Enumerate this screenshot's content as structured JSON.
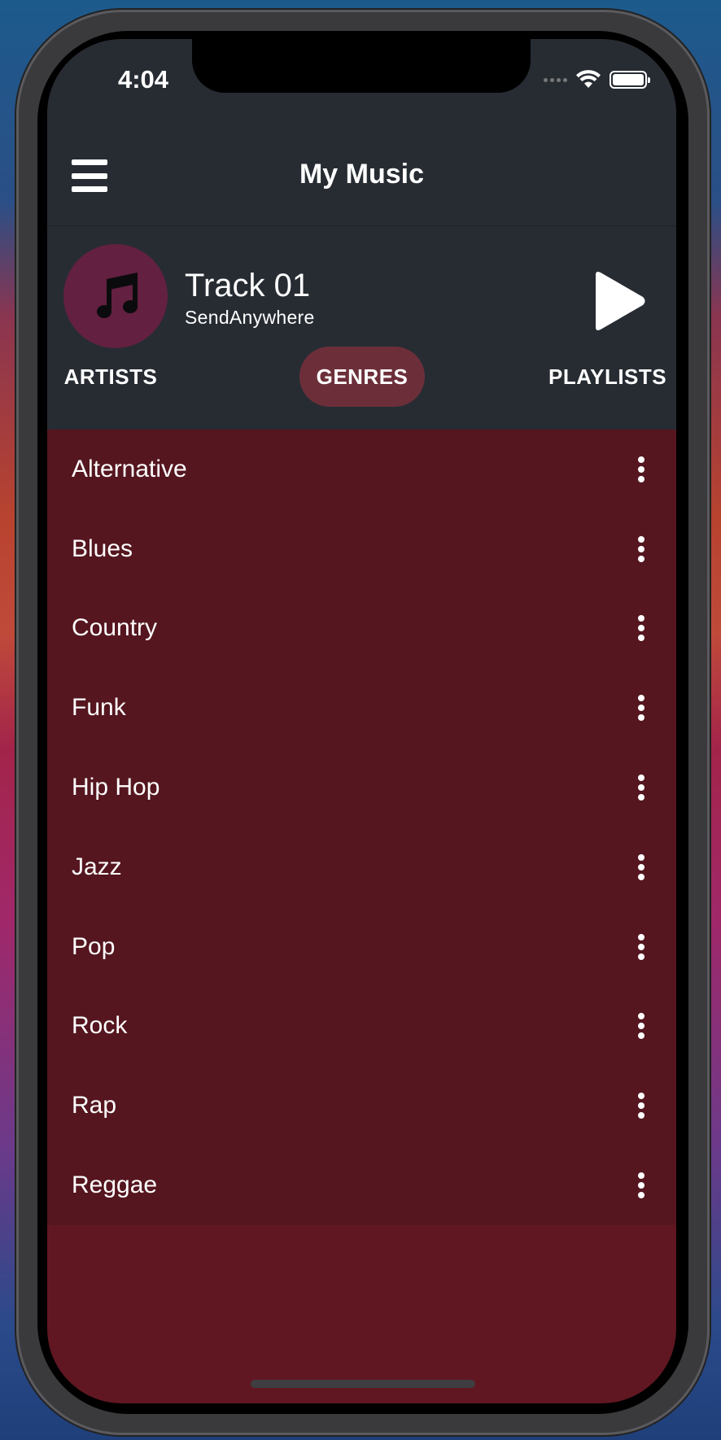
{
  "status_bar": {
    "time": "4:04"
  },
  "header": {
    "title": "My Music"
  },
  "now_playing": {
    "track": "Track 01",
    "artist": "SendAnywhere"
  },
  "tabs": [
    {
      "label": "ARTISTS"
    },
    {
      "label": "GENRES",
      "active": true
    },
    {
      "label": "PLAYLISTS"
    }
  ],
  "genres": [
    {
      "label": "Alternative"
    },
    {
      "label": "Blues"
    },
    {
      "label": "Country"
    },
    {
      "label": "Funk"
    },
    {
      "label": "Hip Hop"
    },
    {
      "label": "Jazz"
    },
    {
      "label": "Pop"
    },
    {
      "label": "Rock"
    },
    {
      "label": "Rap"
    },
    {
      "label": "Reggae"
    }
  ],
  "colors": {
    "header_bg": "#272c33",
    "list_bg": "#55161f",
    "footer_bg": "#611722",
    "active_tab": "#6c2f3a",
    "album_circle": "#632040"
  },
  "icons": {
    "menu": "hamburger-icon",
    "album": "music-note-icon",
    "play": "play-icon",
    "row_action": "more-vertical-icon"
  }
}
